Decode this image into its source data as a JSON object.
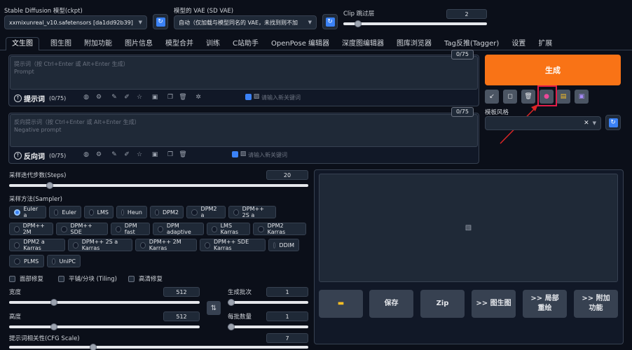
{
  "top": {
    "model_label": "Stable Diffusion 模型(ckpt)",
    "model_value": "xxmixunreal_v10.safetensors [da1dd92b39]",
    "vae_label": "模型的 VAE (SD VAE)",
    "vae_value": "自动（仅加载与模型同名的 VAE，未找到则不加",
    "clip_label": "Clip 跳过层",
    "clip_value": "2"
  },
  "tabs": [
    "文生图",
    "图生图",
    "附加功能",
    "图片信息",
    "模型合并",
    "训练",
    "C站助手",
    "OpenPose 编辑器",
    "深度图编辑器",
    "图库浏览器",
    "Tag反推(Tagger)",
    "设置",
    "扩展"
  ],
  "prompt": {
    "placeholder_line1": "提示词（按 Ctrl+Enter 或 Alt+Enter 生成）",
    "placeholder_line2": "Prompt",
    "counter": "0/75",
    "label": "提示词",
    "label_count": "(0/75)",
    "keyword_placeholder": "请输入新关键词"
  },
  "negative": {
    "placeholder_line1": "反向提示词（按 Ctrl+Enter 或 Alt+Enter 生成）",
    "placeholder_line2": "Negative prompt",
    "counter": "0/75",
    "label": "反向词",
    "label_count": "(0/75)",
    "keyword_placeholder": "请输入新关键词"
  },
  "generate": {
    "label": "生成",
    "color": "#f97316",
    "style_label": "模板风格"
  },
  "steps": {
    "label": "采样迭代步数(Steps)",
    "value": "20",
    "fraction": 0.13
  },
  "sampler": {
    "label": "采样方法(Sampler)",
    "options": [
      "Euler a",
      "Euler",
      "LMS",
      "Heun",
      "DPM2",
      "DPM2 a",
      "DPM++ 2S a",
      "DPM++ 2M",
      "DPM++ SDE",
      "DPM fast",
      "DPM adaptive",
      "LMS Karras",
      "DPM2 Karras",
      "DPM2 a Karras",
      "DPM++ 2S a Karras",
      "DPM++ 2M Karras",
      "DPM++ SDE Karras",
      "DDIM",
      "PLMS",
      "UniPC"
    ],
    "selected": "Euler a"
  },
  "checks": {
    "face": "面部修复",
    "tiling": "平铺/分块 (Tiling)",
    "hires": "高清修复"
  },
  "width": {
    "label": "宽度",
    "value": "512"
  },
  "height": {
    "label": "高度",
    "value": "512"
  },
  "batch_count": {
    "label": "生成批次",
    "value": "1"
  },
  "batch_size": {
    "label": "每批数量",
    "value": "1"
  },
  "cfg": {
    "label": "提示词相关性(CFG Scale)",
    "value": "7"
  },
  "output_buttons": {
    "save": "保存",
    "zip": "Zip",
    "to_img2img": ">> 图生图",
    "to_inpaint": ">> 局部重绘",
    "to_extras": ">> 附加功能"
  }
}
